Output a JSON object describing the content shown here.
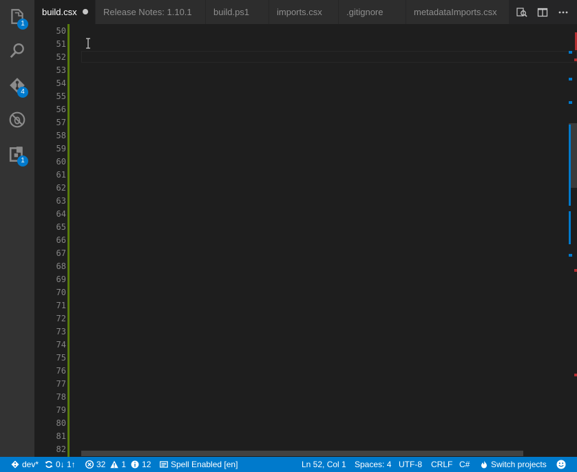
{
  "activity_bar": {
    "explorer_badge": "1",
    "git_badge": "4",
    "extensions_badge": "1"
  },
  "tabs": [
    {
      "label": "build.csx",
      "active": true,
      "dirty": true
    },
    {
      "label": "Release Notes: 1.10.1"
    },
    {
      "label": "build.ps1"
    },
    {
      "label": "imports.csx"
    },
    {
      "label": ".gitignore"
    },
    {
      "label": "metadataImports.csx"
    }
  ],
  "editor": {
    "line_numbers": [
      "50",
      "51",
      "52",
      "53",
      "54",
      "55",
      "56",
      "57",
      "58",
      "59",
      "60",
      "61",
      "62",
      "63",
      "64",
      "65",
      "66",
      "67",
      "68",
      "69",
      "70",
      "71",
      "72",
      "73",
      "74",
      "75",
      "76",
      "77",
      "78",
      "79",
      "80",
      "81",
      "82"
    ]
  },
  "status_bar": {
    "branch": "dev*",
    "sync": "0↓ 1↑",
    "errors": "32",
    "warnings": "1",
    "infos": "12",
    "spell": "Spell Enabled [en]",
    "position": "Ln 52, Col 1",
    "spaces": "Spaces: 4",
    "encoding": "UTF-8",
    "eol": "CRLF",
    "language": "C#",
    "switch_projects": "Switch projects"
  },
  "colors": {
    "accent": "#007acc",
    "git_added": "#587c0c",
    "error_marker": "#b52e31",
    "info_marker": "#007acc"
  }
}
